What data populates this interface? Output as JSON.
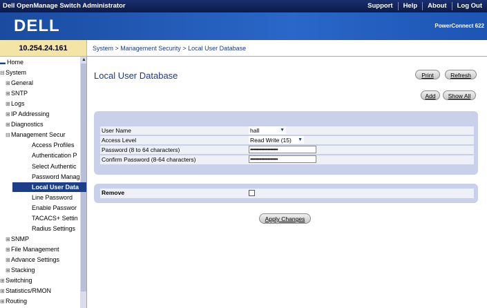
{
  "header": {
    "app_title": "Dell OpenManage Switch Administrator",
    "links": [
      "Support",
      "Help",
      "About",
      "Log Out"
    ],
    "logo": "DELL",
    "product": "PowerConnect 622"
  },
  "ip_address": "10.254.24.161",
  "breadcrumb": "System > Management Security > Local User Database",
  "nav": {
    "items": [
      {
        "label": "Home",
        "expander": "",
        "icon": "home-icon"
      },
      {
        "label": "System",
        "expander": "⊟"
      },
      {
        "label": "General",
        "expander": "⊞"
      },
      {
        "label": "SNTP",
        "expander": "⊞"
      },
      {
        "label": "Logs",
        "expander": "⊞"
      },
      {
        "label": "IP Addressing",
        "expander": "⊞"
      },
      {
        "label": "Diagnostics",
        "expander": "⊞"
      },
      {
        "label": "Management Secur",
        "expander": "⊟"
      },
      {
        "label": "Access Profiles",
        "expander": ""
      },
      {
        "label": "Authentication P",
        "expander": ""
      },
      {
        "label": "Select Authentic",
        "expander": ""
      },
      {
        "label": "Password Manag",
        "expander": ""
      },
      {
        "label": "Local User Data",
        "expander": "",
        "selected": true
      },
      {
        "label": "Line Password",
        "expander": ""
      },
      {
        "label": "Enable Passwor",
        "expander": ""
      },
      {
        "label": "TACACS+ Settin",
        "expander": ""
      },
      {
        "label": "Radius Settings",
        "expander": ""
      },
      {
        "label": "SNMP",
        "expander": "⊞"
      },
      {
        "label": "File Management",
        "expander": "⊞"
      },
      {
        "label": "Advance Settings",
        "expander": "⊞"
      },
      {
        "label": "Stacking",
        "expander": "⊞"
      },
      {
        "label": "Switching",
        "expander": "⊞"
      },
      {
        "label": "Statistics/RMON",
        "expander": "⊞"
      },
      {
        "label": "Routing",
        "expander": "⊞"
      }
    ]
  },
  "main": {
    "title": "Local User Database",
    "buttons": {
      "print": "Print",
      "refresh": "Refresh",
      "add": "Add",
      "show_all": "Show All",
      "apply": "Apply Changes"
    },
    "form": {
      "user_name_label": "User Name",
      "user_name_value": "hall",
      "access_level_label": "Access Level",
      "access_level_value": "Read Write (15)",
      "password_label": "Password (8 to 64 characters)",
      "password_mask": "••••••••••••••••••••••",
      "confirm_label": "Confirm Password (8-64 characters)",
      "confirm_mask": "••••••••••••••••••••••"
    },
    "remove_label": "Remove",
    "remove_checked": false
  },
  "colors": {
    "header_bg": "#0b1a4a",
    "brand_bg": "#2a67c8",
    "panel_bg": "#c9d0ea",
    "selected_nav_bg": "#1d3f8a",
    "ip_box_bg": "#f4e4a5"
  }
}
